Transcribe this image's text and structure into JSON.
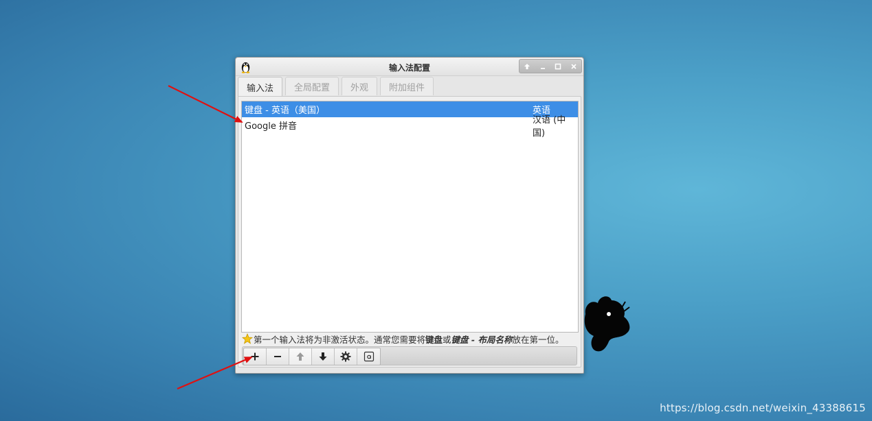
{
  "window": {
    "title": "输入法配置",
    "controls": [
      "up-arrow-icon",
      "minimize-icon",
      "maximize-icon",
      "close-icon"
    ]
  },
  "tabs": [
    {
      "label": "输入法",
      "active": true
    },
    {
      "label": "全局配置",
      "active": false
    },
    {
      "label": "外观",
      "active": false
    },
    {
      "label": "附加组件",
      "active": false
    }
  ],
  "input_methods": [
    {
      "name": "键盘 - 英语（美国）",
      "language": "英语",
      "selected": true
    },
    {
      "name": "Google 拼音",
      "language": "汉语 (中国)",
      "selected": false
    }
  ],
  "hint": {
    "prefix": "第一个输入法将为非激活状态。通常您需要将",
    "kw1": "键盘",
    "mid": "或",
    "kw2": "键盘 - 布局名称",
    "suffix": "放在第一位。"
  },
  "toolbar": {
    "buttons": [
      {
        "icon": "plus-icon",
        "enabled": true
      },
      {
        "icon": "minus-icon",
        "enabled": true
      },
      {
        "icon": "arrow-up-icon",
        "enabled": false
      },
      {
        "icon": "arrow-down-icon",
        "enabled": true
      },
      {
        "icon": "gear-icon",
        "enabled": true
      },
      {
        "icon": "keyboard-layout-icon",
        "enabled": true
      }
    ]
  },
  "watermark": "https://blog.csdn.net/weixin_43388615",
  "colors": {
    "selection": "#3d8ee6",
    "annotation_arrow": "#e01010"
  }
}
